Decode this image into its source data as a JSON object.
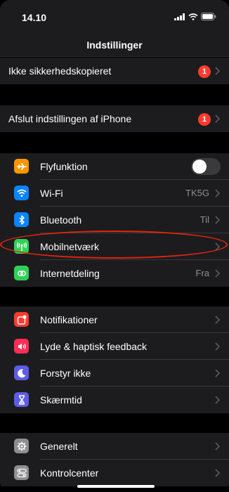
{
  "status_bar": {
    "time": "14.10"
  },
  "nav": {
    "title": "Indstillinger"
  },
  "section1": [
    {
      "label": "Ikke sikkerhedskopieret",
      "badge": "1"
    }
  ],
  "section2": [
    {
      "label": "Afslut indstillingen af iPhone",
      "badge": "1"
    }
  ],
  "section3": [
    {
      "label": "Flyfunktion",
      "icon": "airplane-icon",
      "icon_color": "#ff9500",
      "toggle": "off"
    },
    {
      "label": "Wi-Fi",
      "icon": "wifi-icon",
      "icon_color": "#0a84ff",
      "value": "TK5G"
    },
    {
      "label": "Bluetooth",
      "icon": "bluetooth-icon",
      "icon_color": "#0a84ff",
      "value": "Til"
    },
    {
      "label": "Mobilnetværk",
      "icon": "cellular-icon",
      "icon_color": "#30d158"
    },
    {
      "label": "Internetdeling",
      "icon": "hotspot-icon",
      "icon_color": "#30d158",
      "value": "Fra"
    }
  ],
  "section4": [
    {
      "label": "Notifikationer",
      "icon": "notifications-icon",
      "icon_color": "#ff3b30"
    },
    {
      "label": "Lyde & haptisk feedback",
      "icon": "sounds-icon",
      "icon_color": "#ff2d55"
    },
    {
      "label": "Forstyr ikke",
      "icon": "moon-icon",
      "icon_color": "#5e5ce6"
    },
    {
      "label": "Skærmtid",
      "icon": "hourglass-icon",
      "icon_color": "#5e5ce6"
    }
  ],
  "section5": [
    {
      "label": "Generelt",
      "icon": "gear-icon",
      "icon_color": "#8e8e93"
    },
    {
      "label": "Kontrolcenter",
      "icon": "control-center-icon",
      "icon_color": "#8e8e93"
    }
  ],
  "annotation": {
    "color": "#e3240f"
  }
}
